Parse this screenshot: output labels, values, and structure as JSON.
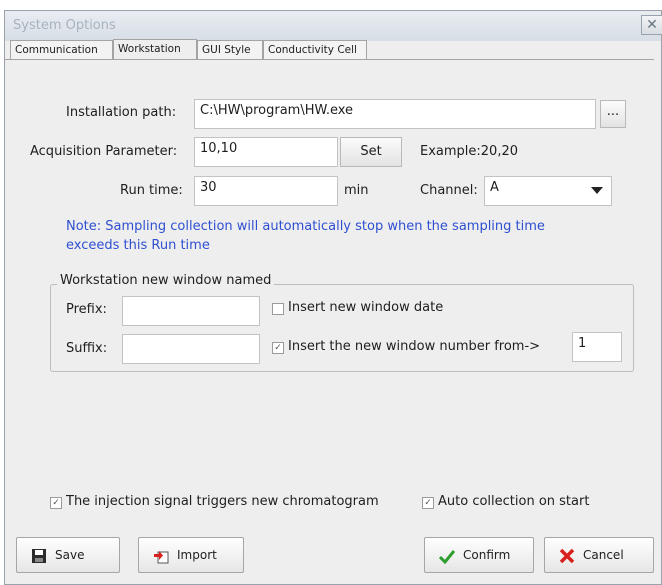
{
  "window": {
    "title": "System Options",
    "close_glyph": "✕"
  },
  "tabs": [
    {
      "label": "Communication",
      "active": false
    },
    {
      "label": "Workstation",
      "active": true
    },
    {
      "label": "GUI Style",
      "active": false
    },
    {
      "label": "Conductivity Cell",
      "active": false
    }
  ],
  "installation": {
    "label": "Installation path:",
    "value": "C:\\HW\\program\\HW.exe",
    "browse_label": "..."
  },
  "acquisition": {
    "label": "Acquisition Parameter:",
    "value": "10,10",
    "set_label": "Set",
    "example": "Example:20,20"
  },
  "runtime": {
    "label": "Run time:",
    "value": "30",
    "unit": "min",
    "channel_label": "Channel:",
    "channel_value": "A"
  },
  "note": {
    "line1": "Note: Sampling collection will automatically stop when the sampling time",
    "line2": "exceeds this Run time"
  },
  "group": {
    "title": "Workstation new window named",
    "prefix_label": "Prefix:",
    "prefix_value": "",
    "suffix_label": "Suffix:",
    "suffix_value": "",
    "insert_date_label": "Insert new window date",
    "insert_date_checked": false,
    "insert_number_label": "Insert the new window number from->",
    "insert_number_checked": true,
    "insert_number_value": "1"
  },
  "options": {
    "injection_label": "The injection signal triggers new chromatogram",
    "injection_checked": true,
    "auto_label": "Auto collection on start",
    "auto_checked": true
  },
  "buttons": {
    "save": "Save",
    "import": "Import",
    "confirm": "Confirm",
    "cancel": "Cancel"
  },
  "colors": {
    "note": "#2f4fd1",
    "confirm_icon": "#2e9e2e",
    "cancel_icon": "#d8201c"
  }
}
